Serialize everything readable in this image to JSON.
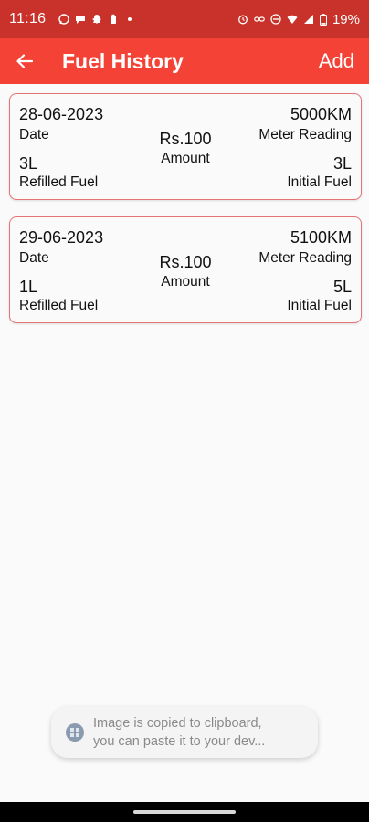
{
  "status_bar": {
    "time": "11:16",
    "battery": "19%",
    "left_icons": [
      "whatsapp-icon",
      "chat-icon",
      "snapchat-icon",
      "battery-saver-icon",
      "dot-icon"
    ],
    "right_icons": [
      "alarm-icon",
      "link-icon",
      "do-not-disturb-icon",
      "wifi-icon",
      "signal-icon",
      "battery-icon"
    ]
  },
  "app_bar": {
    "title": "Fuel History",
    "add_label": "Add",
    "background": "#f44336"
  },
  "labels": {
    "date": "Date",
    "amount": "Amount",
    "meter_reading": "Meter Reading",
    "refilled_fuel": "Refilled Fuel",
    "initial_fuel": "Initial Fuel"
  },
  "entries": [
    {
      "date": "28-06-2023",
      "amount": "Rs.100",
      "meter_reading": "5000KM",
      "refilled_fuel": "3L",
      "initial_fuel": "3L"
    },
    {
      "date": "29-06-2023",
      "amount": "Rs.100",
      "meter_reading": "5100KM",
      "refilled_fuel": "1L",
      "initial_fuel": "5L"
    }
  ],
  "toast": {
    "line1": "Image is copied to clipboard,",
    "line2": "you can paste it to your dev..."
  },
  "colors": {
    "accent": "#f44336",
    "status_bar": "#c8322a",
    "card_border": "#e57373"
  }
}
